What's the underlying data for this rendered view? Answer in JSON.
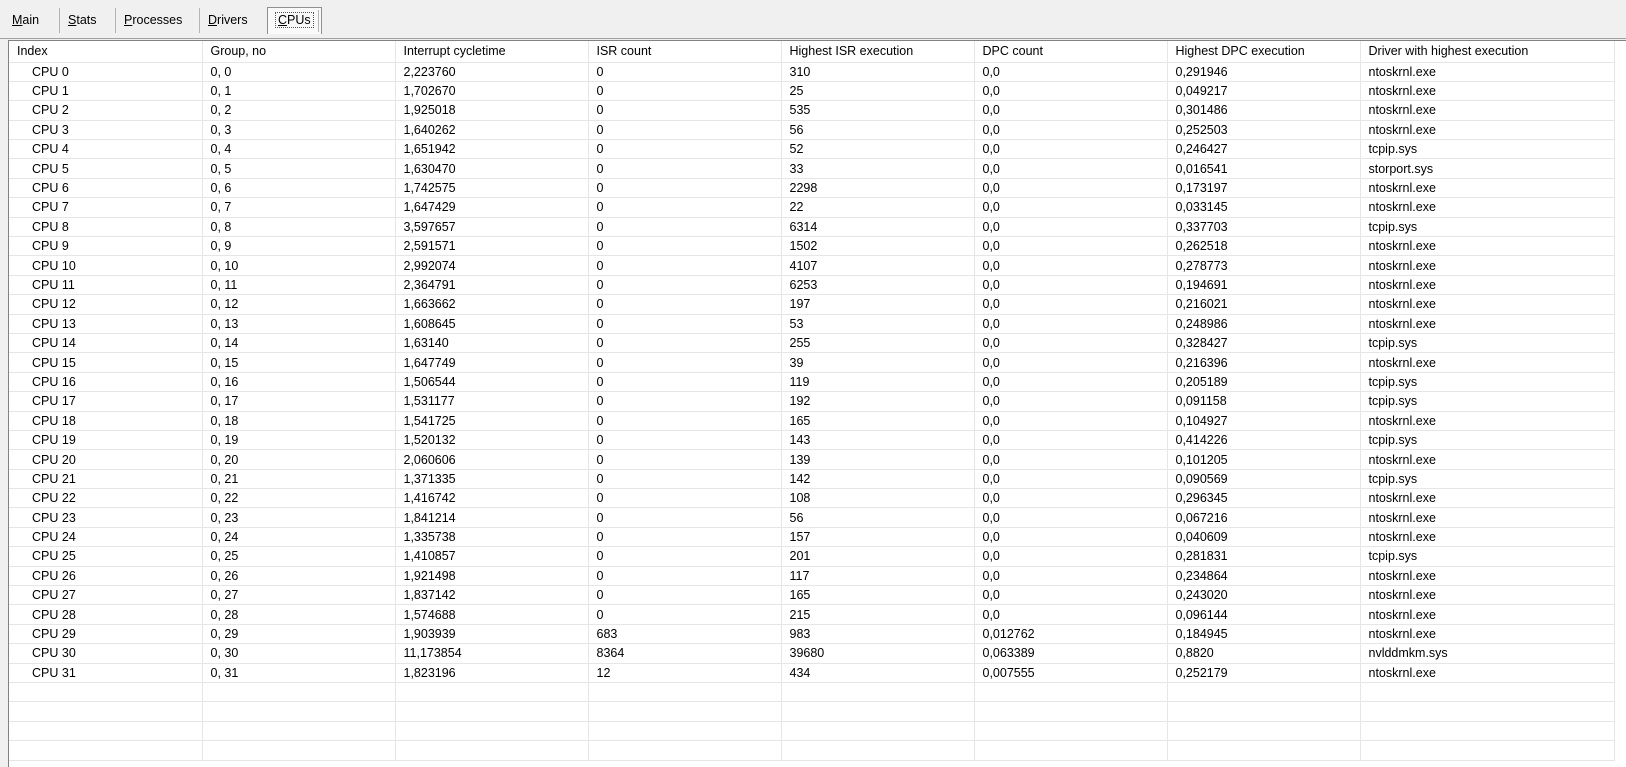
{
  "tabs": [
    {
      "label": "Main",
      "underline": "M",
      "rest": "ain",
      "name": "tab-main",
      "selected": false
    },
    {
      "label": "Stats",
      "underline": "S",
      "rest": "tats",
      "name": "tab-stats",
      "selected": false
    },
    {
      "label": "Processes",
      "underline": "P",
      "rest": "rocesses",
      "name": "tab-processes",
      "selected": false
    },
    {
      "label": "Drivers",
      "underline": "D",
      "rest": "rivers",
      "name": "tab-drivers",
      "selected": false
    },
    {
      "label": "CPUs",
      "underline": "C",
      "rest": "PUs",
      "name": "tab-cpus",
      "selected": true
    }
  ],
  "table": {
    "columns": [
      "Index",
      "Group, no",
      "Interrupt cycletime",
      "ISR count",
      "Highest ISR execution",
      "DPC count",
      "Highest DPC execution",
      "Driver with highest execution"
    ],
    "rows": [
      [
        "CPU 0",
        "0, 0",
        "2,223760",
        "0",
        "310",
        "0,0",
        "0,291946",
        "ntoskrnl.exe"
      ],
      [
        "CPU 1",
        "0, 1",
        "1,702670",
        "0",
        "25",
        "0,0",
        "0,049217",
        "ntoskrnl.exe"
      ],
      [
        "CPU 2",
        "0, 2",
        "1,925018",
        "0",
        "535",
        "0,0",
        "0,301486",
        "ntoskrnl.exe"
      ],
      [
        "CPU 3",
        "0, 3",
        "1,640262",
        "0",
        "56",
        "0,0",
        "0,252503",
        "ntoskrnl.exe"
      ],
      [
        "CPU 4",
        "0, 4",
        "1,651942",
        "0",
        "52",
        "0,0",
        "0,246427",
        "tcpip.sys"
      ],
      [
        "CPU 5",
        "0, 5",
        "1,630470",
        "0",
        "33",
        "0,0",
        "0,016541",
        "storport.sys"
      ],
      [
        "CPU 6",
        "0, 6",
        "1,742575",
        "0",
        "2298",
        "0,0",
        "0,173197",
        "ntoskrnl.exe"
      ],
      [
        "CPU 7",
        "0, 7",
        "1,647429",
        "0",
        "22",
        "0,0",
        "0,033145",
        "ntoskrnl.exe"
      ],
      [
        "CPU 8",
        "0, 8",
        "3,597657",
        "0",
        "6314",
        "0,0",
        "0,337703",
        "tcpip.sys"
      ],
      [
        "CPU 9",
        "0, 9",
        "2,591571",
        "0",
        "1502",
        "0,0",
        "0,262518",
        "ntoskrnl.exe"
      ],
      [
        "CPU 10",
        "0, 10",
        "2,992074",
        "0",
        "4107",
        "0,0",
        "0,278773",
        "ntoskrnl.exe"
      ],
      [
        "CPU 11",
        "0, 11",
        "2,364791",
        "0",
        "6253",
        "0,0",
        "0,194691",
        "ntoskrnl.exe"
      ],
      [
        "CPU 12",
        "0, 12",
        "1,663662",
        "0",
        "197",
        "0,0",
        "0,216021",
        "ntoskrnl.exe"
      ],
      [
        "CPU 13",
        "0, 13",
        "1,608645",
        "0",
        "53",
        "0,0",
        "0,248986",
        "ntoskrnl.exe"
      ],
      [
        "CPU 14",
        "0, 14",
        "1,63140",
        "0",
        "255",
        "0,0",
        "0,328427",
        "tcpip.sys"
      ],
      [
        "CPU 15",
        "0, 15",
        "1,647749",
        "0",
        "39",
        "0,0",
        "0,216396",
        "ntoskrnl.exe"
      ],
      [
        "CPU 16",
        "0, 16",
        "1,506544",
        "0",
        "119",
        "0,0",
        "0,205189",
        "tcpip.sys"
      ],
      [
        "CPU 17",
        "0, 17",
        "1,531177",
        "0",
        "192",
        "0,0",
        "0,091158",
        "tcpip.sys"
      ],
      [
        "CPU 18",
        "0, 18",
        "1,541725",
        "0",
        "165",
        "0,0",
        "0,104927",
        "ntoskrnl.exe"
      ],
      [
        "CPU 19",
        "0, 19",
        "1,520132",
        "0",
        "143",
        "0,0",
        "0,414226",
        "tcpip.sys"
      ],
      [
        "CPU 20",
        "0, 20",
        "2,060606",
        "0",
        "139",
        "0,0",
        "0,101205",
        "ntoskrnl.exe"
      ],
      [
        "CPU 21",
        "0, 21",
        "1,371335",
        "0",
        "142",
        "0,0",
        "0,090569",
        "tcpip.sys"
      ],
      [
        "CPU 22",
        "0, 22",
        "1,416742",
        "0",
        "108",
        "0,0",
        "0,296345",
        "ntoskrnl.exe"
      ],
      [
        "CPU 23",
        "0, 23",
        "1,841214",
        "0",
        "56",
        "0,0",
        "0,067216",
        "ntoskrnl.exe"
      ],
      [
        "CPU 24",
        "0, 24",
        "1,335738",
        "0",
        "157",
        "0,0",
        "0,040609",
        "ntoskrnl.exe"
      ],
      [
        "CPU 25",
        "0, 25",
        "1,410857",
        "0",
        "201",
        "0,0",
        "0,281831",
        "tcpip.sys"
      ],
      [
        "CPU 26",
        "0, 26",
        "1,921498",
        "0",
        "117",
        "0,0",
        "0,234864",
        "ntoskrnl.exe"
      ],
      [
        "CPU 27",
        "0, 27",
        "1,837142",
        "0",
        "165",
        "0,0",
        "0,243020",
        "ntoskrnl.exe"
      ],
      [
        "CPU 28",
        "0, 28",
        "1,574688",
        "0",
        "215",
        "0,0",
        "0,096144",
        "ntoskrnl.exe"
      ],
      [
        "CPU 29",
        "0, 29",
        "1,903939",
        "683",
        "983",
        "0,012762",
        "0,184945",
        "ntoskrnl.exe"
      ],
      [
        "CPU 30",
        "0, 30",
        "11,173854",
        "8364",
        "39680",
        "0,063389",
        "0,8820",
        "nvlddmkm.sys"
      ],
      [
        "CPU 31",
        "0, 31",
        "1,823196",
        "12",
        "434",
        "0,007555",
        "0,252179",
        "ntoskrnl.exe"
      ]
    ]
  }
}
